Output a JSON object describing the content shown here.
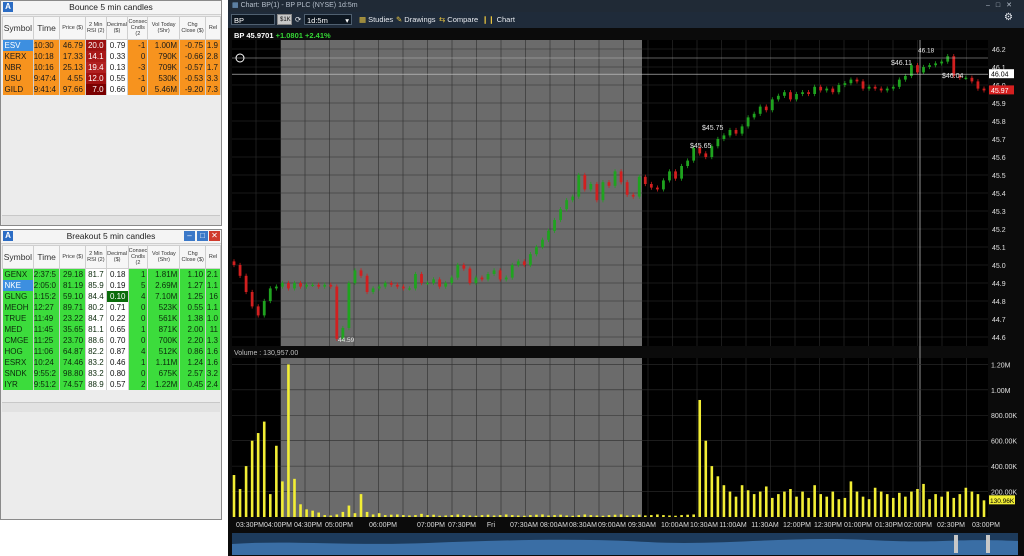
{
  "bounce": {
    "title": "Bounce 5 min candles",
    "columns": [
      "Symbol",
      "Time",
      "Price ($)",
      "2 Min RSI (2)",
      "Decimal ($)",
      "Consec Cndls (2",
      "Vol Today (Shr)",
      "Chg Close ($)",
      "Rel"
    ],
    "rows": [
      [
        "ESV",
        "10:30",
        "46.79",
        "20.0",
        "0.79",
        "-1",
        "1.00M",
        "-0.75",
        "1.9"
      ],
      [
        "KERX",
        "10:18",
        "17.33",
        "14.1",
        "0.33",
        "0",
        "790K",
        "-0.66",
        "2.8"
      ],
      [
        "NBR",
        "10:16",
        "25.13",
        "19.4",
        "0.13",
        "-3",
        "709K",
        "-0.57",
        "1.7"
      ],
      [
        "USU",
        "9:47:4",
        "4.55",
        "12.0",
        "0.55",
        "-1",
        "530K",
        "-0.53",
        "3.3"
      ],
      [
        "GILD",
        "9:41:4",
        "97.66",
        "7.0",
        "0.66",
        "0",
        "5.46M",
        "-9.20",
        "7.3"
      ]
    ]
  },
  "breakout": {
    "title": "Breakout 5 min candles",
    "columns": [
      "Symbol",
      "Time",
      "Price ($)",
      "2 Min RSI (2)",
      "Decimal ($)",
      "Consec Cndls (2",
      "Vol Today (Shr)",
      "Chg Close ($)",
      "Rel"
    ],
    "rows": [
      [
        "GENX",
        "2:37:5",
        "29.18",
        "81.7",
        "0.18",
        "1",
        "1.81M",
        "1.10",
        "2.1"
      ],
      [
        "NKE",
        "2:05:0",
        "81.19",
        "85.9",
        "0.19",
        "5",
        "2.69M",
        "1.27",
        "1.1"
      ],
      [
        "GLNG",
        "1:15:2",
        "59.10",
        "84.4",
        "0.10",
        "4",
        "7.10M",
        "1.25",
        "16"
      ],
      [
        "MEOH",
        "12:27",
        "89.71",
        "80.2",
        "0.71",
        "0",
        "523K",
        "0.55",
        "1.1"
      ],
      [
        "TRUE",
        "11:49",
        "23.22",
        "84.7",
        "0.22",
        "0",
        "561K",
        "1.38",
        "1.0"
      ],
      [
        "MED",
        "11:45",
        "35.65",
        "81.1",
        "0.65",
        "1",
        "871K",
        "2.00",
        "11"
      ],
      [
        "CMGE",
        "11:25",
        "23.70",
        "88.6",
        "0.70",
        "0",
        "700K",
        "2.20",
        "1.3"
      ],
      [
        "HOG",
        "11:06",
        "64.87",
        "82.2",
        "0.87",
        "4",
        "512K",
        "0.86",
        "1.6"
      ],
      [
        "ESRX",
        "10:24",
        "74.46",
        "83.2",
        "0.46",
        "1",
        "1.11M",
        "1.24",
        "1.6"
      ],
      [
        "SNDK",
        "9:55:2",
        "98.80",
        "83.2",
        "0.80",
        "0",
        "675K",
        "2.57",
        "3.2"
      ],
      [
        "IYR",
        "9:51:2",
        "74.57",
        "88.9",
        "0.57",
        "2",
        "1.22M",
        "0.45",
        "2.4"
      ]
    ]
  },
  "chart_window": {
    "title": "Chart: BP(1) - BP PLC (NYSE) 1d:5m",
    "symbol": "BP",
    "link_badge": "$1K",
    "interval": "1d:5m",
    "toolbar": {
      "studies": "Studies",
      "drawings": "Drawings",
      "compare": "Compare",
      "chart": "Chart"
    },
    "quote_symbol": "BP",
    "quote_price": "45.9701",
    "quote_change": "+1.0801  +2.41%",
    "volume_label": "Volume : 130,957.00"
  },
  "chart_data": {
    "type": "candlestick",
    "price_axis": {
      "ticks": [
        "46.2",
        "46.1",
        "46.0",
        "45.9",
        "45.8",
        "45.7",
        "45.6",
        "45.5",
        "45.4",
        "45.3",
        "45.2",
        "45.1",
        "45.0",
        "44.9",
        "44.8",
        "44.7",
        "44.6"
      ],
      "ylim": [
        44.55,
        46.25
      ]
    },
    "last_price_badges": [
      "46.04",
      "45.97"
    ],
    "annotations": [
      "44.59",
      "$45.65",
      "$45.75",
      "$46.11",
      "46.18",
      "$46.04"
    ],
    "volume_axis": {
      "ticks": [
        "1.20M",
        "1.00M",
        "800.00K",
        "600.00K",
        "400.00K",
        "200.00K"
      ],
      "ylim": [
        0,
        1250000
      ]
    },
    "volume_last_badge": "130.96K",
    "time_labels": [
      "03:30PM",
      "04:00PM",
      "04:30PM",
      "05:00PM",
      "06:00PM",
      "07:00PM",
      "07:30PM",
      "Fri",
      "07:30AM",
      "08:00AM",
      "08:30AM",
      "09:00AM",
      "09:30AM",
      "10:00AM",
      "10:30AM",
      "11:00AM",
      "11:30AM",
      "12:00PM",
      "12:30PM",
      "01:00PM",
      "01:30PM",
      "02:00PM",
      "02:30PM",
      "03:00PM"
    ],
    "closes": [
      45.0,
      44.94,
      44.85,
      44.77,
      44.72,
      44.8,
      44.87,
      44.88,
      44.9,
      44.87,
      44.9,
      44.88,
      44.89,
      44.89,
      44.88,
      44.89,
      44.88,
      44.59,
      44.65,
      44.9,
      44.97,
      44.94,
      44.85,
      44.87,
      44.88,
      44.9,
      44.89,
      44.88,
      44.87,
      44.87,
      44.95,
      44.9,
      44.9,
      44.92,
      44.88,
      44.9,
      44.93,
      45.0,
      44.98,
      44.9,
      44.93,
      44.92,
      44.95,
      44.97,
      44.92,
      44.93,
      45.0,
      45.02,
      45.0,
      45.06,
      45.1,
      45.14,
      45.19,
      45.25,
      45.31,
      45.36,
      45.38,
      45.5,
      45.42,
      45.45,
      45.36,
      45.46,
      45.44,
      45.52,
      45.46,
      45.39,
      45.38,
      45.49,
      45.45,
      45.43,
      45.42,
      45.47,
      45.52,
      45.48,
      45.55,
      45.58,
      45.65,
      45.62,
      45.6,
      45.66,
      45.7,
      45.72,
      45.75,
      45.73,
      45.77,
      45.82,
      45.84,
      45.88,
      45.86,
      45.92,
      45.94,
      45.96,
      45.92,
      45.95,
      45.96,
      45.95,
      45.99,
      45.97,
      45.98,
      45.96,
      46.0,
      46.01,
      46.03,
      46.02,
      45.98,
      45.99,
      45.98,
      45.97,
      45.98,
      45.99,
      46.03,
      46.05,
      46.11,
      46.07,
      46.1,
      46.11,
      46.12,
      46.13,
      46.16,
      46.05,
      46.04,
      46.04,
      46.02,
      45.98,
      45.97
    ],
    "volumes": [
      330000,
      220000,
      400000,
      600000,
      660000,
      750000,
      180000,
      560000,
      280000,
      1200000,
      300000,
      100000,
      60000,
      50000,
      35000,
      15000,
      12000,
      20000,
      40000,
      90000,
      30000,
      180000,
      40000,
      20000,
      30000,
      15000,
      18000,
      20000,
      15000,
      12000,
      15000,
      25000,
      15000,
      18000,
      10000,
      12000,
      15000,
      20000,
      15000,
      12000,
      10000,
      15000,
      18000,
      12000,
      15000,
      20000,
      15000,
      12000,
      10000,
      15000,
      18000,
      20000,
      12000,
      15000,
      18000,
      12000,
      10000,
      15000,
      20000,
      15000,
      12000,
      10000,
      15000,
      18000,
      20000,
      12000,
      15000,
      18000,
      12000,
      15000,
      20000,
      15000,
      12000,
      10000,
      15000,
      18000,
      20000,
      920000,
      600000,
      400000,
      320000,
      250000,
      200000,
      160000,
      250000,
      210000,
      180000,
      200000,
      240000,
      150000,
      180000,
      200000,
      220000,
      160000,
      200000,
      150000,
      250000,
      180000,
      160000,
      200000,
      140000,
      150000,
      280000,
      200000,
      160000,
      140000,
      230000,
      200000,
      180000,
      150000,
      190000,
      160000,
      200000,
      220000,
      260000,
      140000,
      180000,
      160000,
      200000,
      150000,
      180000,
      230000,
      200000,
      180000,
      131000
    ]
  }
}
